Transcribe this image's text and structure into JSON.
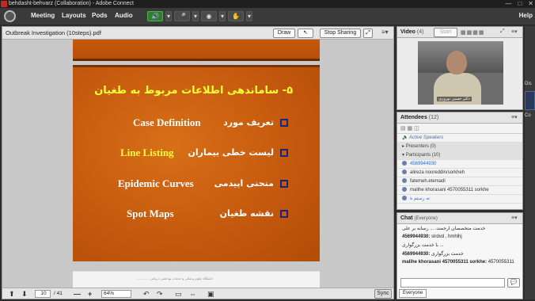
{
  "window": {
    "title": "behdasht-behvarz (Collaboration) - Adobe Connect",
    "controls": [
      "—",
      "□",
      "✕"
    ]
  },
  "menubar": {
    "items": [
      "Meeting",
      "Layouts",
      "Pods",
      "Audio"
    ],
    "help": "Help"
  },
  "share_pod": {
    "title": "Outbreak Investigation (10steps).pdf",
    "draw_label": "Draw",
    "stop_sharing_label": "Stop Sharing",
    "slide": {
      "title": "۵- ساماندهی اطلاعات مربوط به طغیان",
      "rows": [
        {
          "en": "Case Definition",
          "fa": "تعریف مورد"
        },
        {
          "en": "Line Listing",
          "fa": "لیست خطی بیماران"
        },
        {
          "en": "Epidemic Curves",
          "fa": "منحنی اپیدمی"
        },
        {
          "en": "Spot Maps",
          "fa": "نقشه طغیان"
        }
      ],
      "highlight_color": "#ffff33"
    },
    "next_slide_text": "دانشگاه علوم پزشکی و خدمات بهداشتی درمانی ...............",
    "footer": {
      "page_current": "10",
      "page_total": "/ 41",
      "zoom": "64%",
      "sync_label": "Sync"
    }
  },
  "video_pod": {
    "title": "Video",
    "count": "(4)",
    "start_label": "Start",
    "name_tag": "دکتر حسین نوروزی"
  },
  "attendees_pod": {
    "title": "Attendees",
    "count": "(12)",
    "active_speakers_label": "Active Speakers",
    "presenters_label": "Presenters (0)",
    "participants_label": "Participants (10)",
    "participants": [
      {
        "name": "4569944930",
        "highlight": true
      },
      {
        "name": "alireza nooreddin/sorkheh",
        "highlight": false
      },
      {
        "name": "fatemeh.etemadi",
        "highlight": false
      },
      {
        "name": "malihe khorasani 4570055311 sorkhe",
        "highlight": false
      },
      {
        "name": "نه رستم ه",
        "highlight": true
      }
    ]
  },
  "chat_pod": {
    "title": "Chat",
    "scope": "(Everyone)",
    "messages": [
      {
        "from": "",
        "text": "خدمت متخصصان ارجمند، ... رسانه بر علی"
      },
      {
        "from": "4569944930:",
        "text": "slrdvd , hmhlhj"
      },
      {
        "from": "",
        "text": "با خدمت بزرگواری ..."
      },
      {
        "from": "4569944930:",
        "text": "خدمت بزرگواری"
      },
      {
        "from": "malihe khorasani 4570055311 sorkhe:",
        "text": "4570055311"
      }
    ],
    "tab_label": "Everyone"
  },
  "edge": {
    "labels": [
      "Hel",
      "Dis",
      "Co"
    ]
  }
}
